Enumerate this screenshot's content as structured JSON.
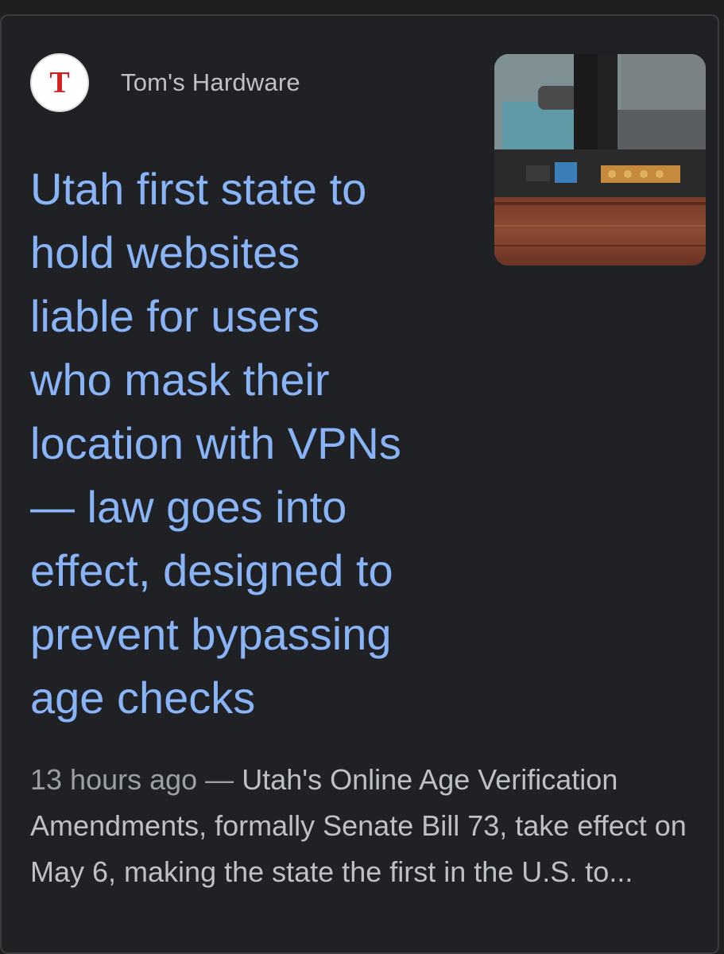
{
  "result": {
    "source_name": "Tom's Hardware",
    "favicon_letter": "T",
    "favicon_color": "#d32020",
    "headline": "Utah first state to\nhold websites\nliable for users\nwho mask their\nlocation with VPNs\n— law goes into\neffect, designed to\nprevent bypassing\nage checks",
    "age": "13 hours ago",
    "separator": " — ",
    "snippet": "Utah's Online Age Verification Amendments, formally Senate Bill 73, take effect on May 6, making the state the first in the U.S. to...",
    "thumbnail_icon": "router-photo-thumbnail",
    "headline_color": "#8ab4f8"
  }
}
